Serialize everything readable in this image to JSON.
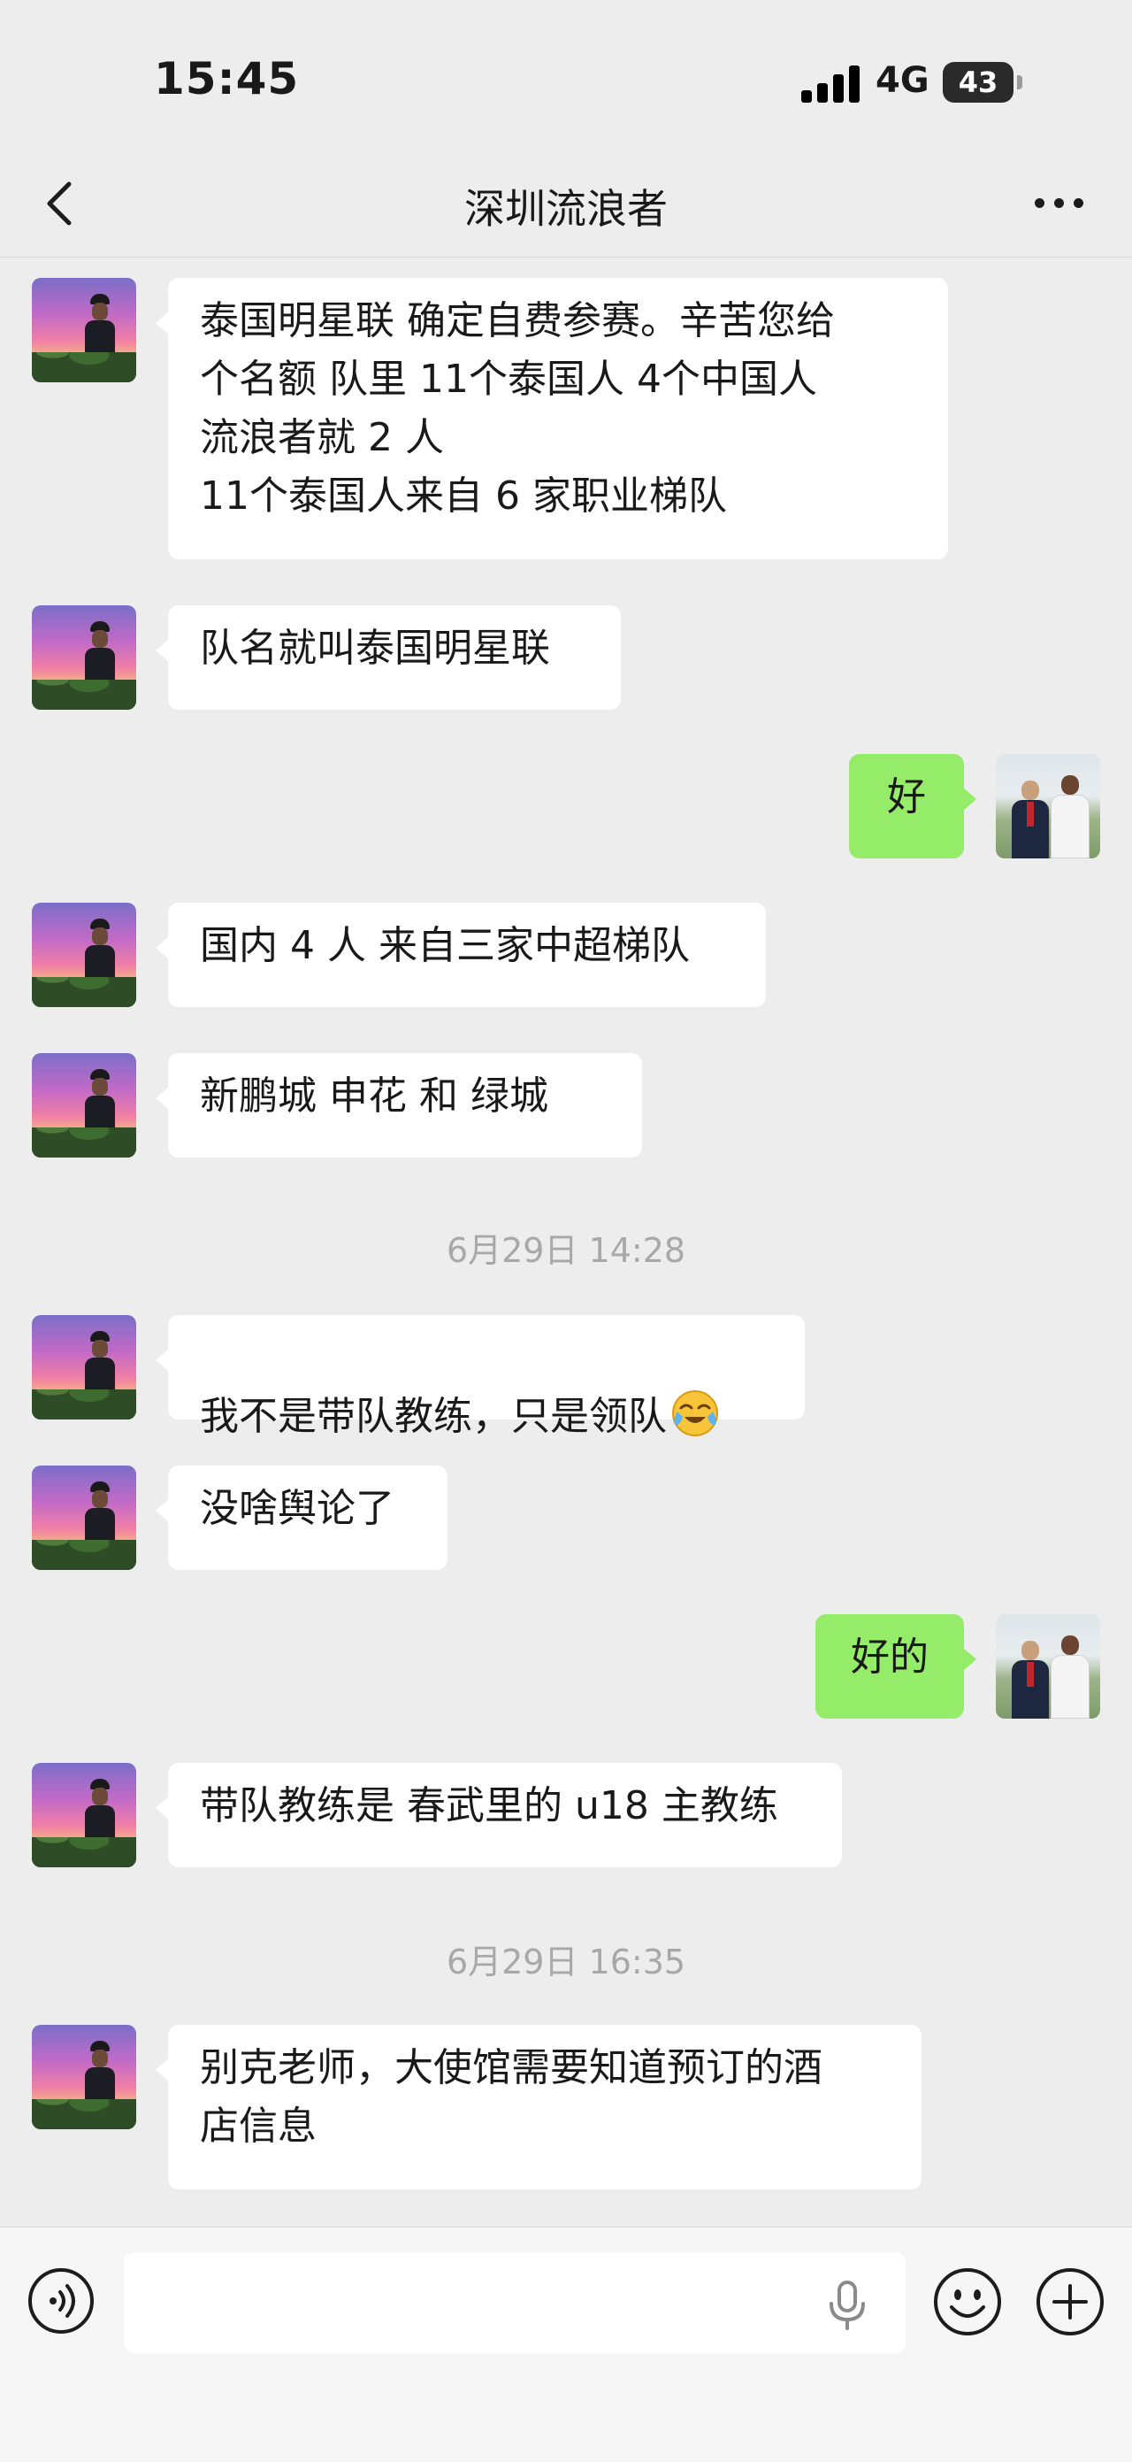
{
  "status_bar": {
    "time": "15:45",
    "network": "4G",
    "battery": "43"
  },
  "header": {
    "title": "深圳流浪者"
  },
  "messages": [
    {
      "text": "泰国明星联 确定自费参赛。辛苦您给\n个名额  队里  11个泰国人  4个中国人\n流浪者就 2 人\n11个泰国人来自 6 家职业梯队"
    },
    {
      "text": "队名就叫泰国明星联"
    },
    {
      "text": "好"
    },
    {
      "text": "国内 4 人  来自三家中超梯队"
    },
    {
      "text": "新鹏城   申花  和 绿城"
    },
    {
      "text": "我不是带队教练，只是领队"
    },
    {
      "text": "没啥舆论了"
    },
    {
      "text": "好的"
    },
    {
      "text": "带队教练是 春武里的 u18 主教练"
    },
    {
      "text": "别克老师，大使馆需要知道预订的酒\n店信息"
    }
  ],
  "timestamps": [
    "6月29日 14:28",
    "6月29日 16:35"
  ],
  "colors": {
    "background": "#ededed",
    "incoming_bubble": "#ffffff",
    "outgoing_bubble": "#95ec69"
  },
  "icons": {
    "back": "chevron-left-icon",
    "more": "more-dots-icon",
    "voice": "voice-mode-icon",
    "mic": "microphone-icon",
    "emoji": "emoji-icon",
    "add": "plus-icon",
    "crying_emoji": "crying-laughing-emoji"
  }
}
